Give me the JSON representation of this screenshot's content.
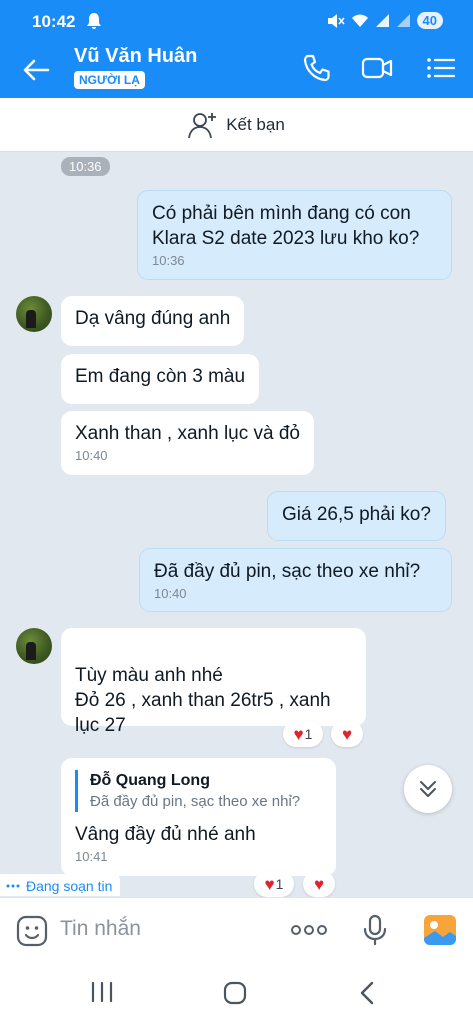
{
  "status_bar": {
    "time": "10:42",
    "battery": "40"
  },
  "header": {
    "contact_name": "Vũ Văn Huân",
    "badge": "NGƯỜI LẠ"
  },
  "add_friend": {
    "label": "Kết bạn"
  },
  "chat": {
    "time_separator": "10:36",
    "messages": [
      {
        "text": "Có phải bên mình đang có con Klara S2 date 2023 lưu kho ko?",
        "time": "10:36"
      },
      {
        "text": "Dạ vâng đúng anh"
      },
      {
        "text": "Em đang còn 3 màu"
      },
      {
        "text": "Xanh than , xanh lục và đỏ",
        "time": "10:40"
      },
      {
        "text": "Giá 26,5 phải ko?"
      },
      {
        "text": "Đã đầy đủ pin, sạc theo xe nhỉ?",
        "time": "10:40"
      },
      {
        "text": "Tùy màu anh nhé\nĐỏ 26 , xanh than 26tr5 , xanh lục 27"
      },
      {
        "quote_author": "Đỗ Quang Long",
        "quote_text": "Đã đầy đủ pin, sạc theo xe nhỉ?",
        "text": "Vâng đầy đủ nhé anh",
        "time": "10:41"
      }
    ],
    "reactions": [
      {
        "icon": "heart",
        "count": "1"
      },
      {
        "icon": "heart",
        "count": "1"
      }
    ],
    "typing": "Đang soạn tin"
  },
  "composer": {
    "placeholder": "Tin nhắn"
  },
  "colors": {
    "primary": "#1a8cf7",
    "outgoing_bubble": "#d6ecfc",
    "incoming_bubble": "#ffffff",
    "chat_bg": "#e2e8ef",
    "heart": "#e0242d"
  }
}
